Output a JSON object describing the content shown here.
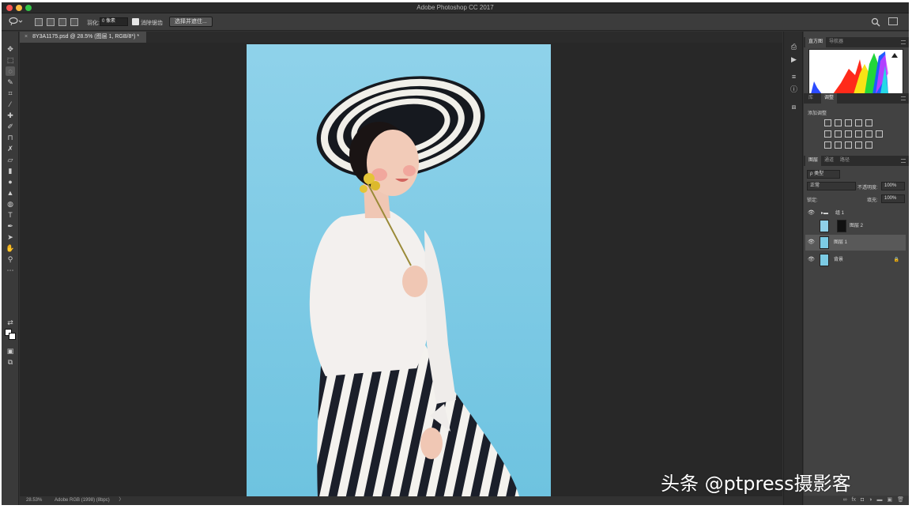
{
  "window": {
    "title": "Adobe Photoshop CC 2017"
  },
  "options_bar": {
    "feather_label": "羽化:",
    "feather_value": "0 像素",
    "antialias_label": "消除锯齿",
    "select_mask_button": "选择并遮住..."
  },
  "document": {
    "tab_title": "8Y3A1175.psd @ 28.5% (图层 1, RGB/8*) *",
    "close_glyph": "×"
  },
  "status": {
    "zoom": "28.53%",
    "profile": "Adobe RGB (1998) (8bpc)",
    "arrow": "〉"
  },
  "panels": {
    "histogram_tabs": [
      "直方图",
      "导航器"
    ],
    "adjust_tabs": [
      "库",
      "调整"
    ],
    "adjust_title": "添加调整",
    "layers_tabs": [
      "图层",
      "通道",
      "路径"
    ],
    "filter_kind": "ρ 类型",
    "blend_mode": "正常",
    "opacity_label": "不透明度:",
    "opacity_value": "100%",
    "lock_label": "锁定:",
    "fill_label": "填充:",
    "fill_value": "100%",
    "layers": [
      {
        "name": "组 1"
      },
      {
        "name": "图层 2"
      },
      {
        "name": "图层 1"
      },
      {
        "name": "背景"
      }
    ]
  },
  "watermark": "头条 @ptpress摄影客",
  "colors": {
    "accent": "#7ccbe4",
    "ui_dark": "#323232",
    "panel": "#424242"
  }
}
